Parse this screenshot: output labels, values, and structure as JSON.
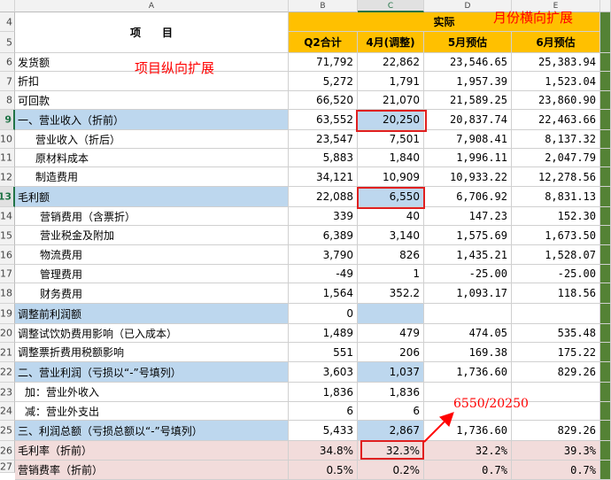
{
  "columns": [
    "A",
    "B",
    "C",
    "D",
    "E"
  ],
  "header": {
    "item_label": "项　　目",
    "actual_label": "实际",
    "sub_headers": [
      "Q2合计",
      "4月(调整)",
      "5月预估",
      "6月预估"
    ]
  },
  "row_numbers": [
    "4",
    "5",
    "6",
    "7",
    "8",
    "9",
    "10",
    "11",
    "12",
    "13",
    "14",
    "15",
    "16",
    "17",
    "18",
    "19",
    "20",
    "21",
    "22",
    "23",
    "24",
    "25",
    "26",
    "27"
  ],
  "rows": [
    {
      "row": "6",
      "label": "发货额",
      "b": "71,792",
      "c": "22,862",
      "d": "23,546.65",
      "e": "25,383.94"
    },
    {
      "row": "7",
      "label": "折扣",
      "b": "5,272",
      "c": "1,791",
      "d": "1,957.39",
      "e": "1,523.04"
    },
    {
      "row": "8",
      "label": "可回款",
      "b": "66,520",
      "c": "21,070",
      "d": "21,589.25",
      "e": "23,860.90"
    },
    {
      "row": "9",
      "label": "一、营业收入（折前）",
      "b": "63,552",
      "c": "20,250",
      "d": "20,837.74",
      "e": "22,463.66"
    },
    {
      "row": "10",
      "label": "营业收入（折后）",
      "b": "23,547",
      "c": "7,501",
      "d": "7,908.41",
      "e": "8,137.32"
    },
    {
      "row": "11",
      "label": "原材料成本",
      "b": "5,883",
      "c": "1,840",
      "d": "1,996.11",
      "e": "2,047.79"
    },
    {
      "row": "12",
      "label": "制造费用",
      "b": "34,121",
      "c": "10,909",
      "d": "10,933.22",
      "e": "12,278.56"
    },
    {
      "row": "13",
      "label": "毛利额",
      "b": "22,088",
      "c": "6,550",
      "d": "6,706.92",
      "e": "8,831.13"
    },
    {
      "row": "14",
      "label": "营销费用（含票折）",
      "b": "339",
      "c": "40",
      "d": "147.23",
      "e": "152.30"
    },
    {
      "row": "15",
      "label": "营业税金及附加",
      "b": "6,389",
      "c": "3,140",
      "d": "1,575.69",
      "e": "1,673.50"
    },
    {
      "row": "16",
      "label": "物流费用",
      "b": "3,790",
      "c": "826",
      "d": "1,435.21",
      "e": "1,528.07"
    },
    {
      "row": "17",
      "label": "管理费用",
      "b": "-49",
      "c": "1",
      "d": "-25.00",
      "e": "-25.00"
    },
    {
      "row": "18",
      "label": "财务费用",
      "b": "1,564",
      "c": "352.2",
      "d": "1,093.17",
      "e": "118.56"
    },
    {
      "row": "19",
      "label": "调整前利润额",
      "b": "0",
      "c": "",
      "d": "",
      "e": ""
    },
    {
      "row": "20",
      "label": "调整试饮奶费用影响（已入成本）",
      "b": "1,489",
      "c": "479",
      "d": "474.05",
      "e": "535.48"
    },
    {
      "row": "21",
      "label": "调整票折费用税额影响",
      "b": "551",
      "c": "206",
      "d": "169.38",
      "e": "175.22"
    },
    {
      "row": "22",
      "label": "二、营业利润（亏损以“-”号填列）",
      "b": "3,603",
      "c": "1,037",
      "d": "1,736.60",
      "e": "829.26"
    },
    {
      "row": "23",
      "label": "加：营业外收入",
      "b": "1,836",
      "c": "1,836",
      "d": "",
      "e": ""
    },
    {
      "row": "24",
      "label": "减：营业外支出",
      "b": "6",
      "c": "6",
      "d": "",
      "e": ""
    },
    {
      "row": "25",
      "label": "三、利润总额（亏损总额以“-”号填列）",
      "b": "5,433",
      "c": "2,867",
      "d": "1,736.60",
      "e": "829.26"
    },
    {
      "row": "26",
      "label": "毛利率（折前）",
      "b": "34.8%",
      "c": "32.3%",
      "d": "32.2%",
      "e": "39.3%"
    },
    {
      "row": "27",
      "label": "营销费率（折前）",
      "b": "0.5%",
      "c": "0.2%",
      "d": "0.7%",
      "e": "0.7%"
    }
  ],
  "annotations": {
    "month_expand": "月份横向扩展",
    "item_expand": "项目纵向扩展",
    "formula": "6550/20250"
  },
  "colors": {
    "header_orange": "#ffc000",
    "highlight_blue": "#bdd7ee",
    "pink": "#f2dcdb",
    "annotation_red": "#ff0000",
    "green_edge": "#548235"
  }
}
